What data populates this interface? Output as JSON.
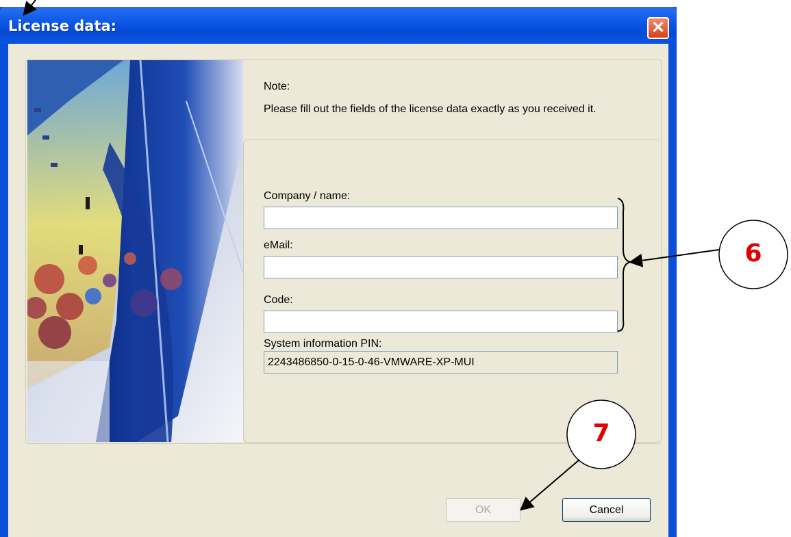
{
  "window": {
    "title": "License data:",
    "close_glyph": "✕"
  },
  "note": {
    "label": "Note:",
    "text": "Please fill out the fields of the license data exactly as you received it."
  },
  "fields": {
    "company": {
      "label": "Company / name:",
      "value": ""
    },
    "email": {
      "label": "eMail:",
      "value": ""
    },
    "code": {
      "label": "Code:",
      "value": ""
    },
    "pin": {
      "label": "System information PIN:",
      "value": "2243486850-0-15-0-46-VMWARE-XP-MUI"
    }
  },
  "buttons": {
    "ok": "OK",
    "cancel": "Cancel"
  },
  "annotations": {
    "callout_6": "6",
    "callout_7": "7"
  }
}
